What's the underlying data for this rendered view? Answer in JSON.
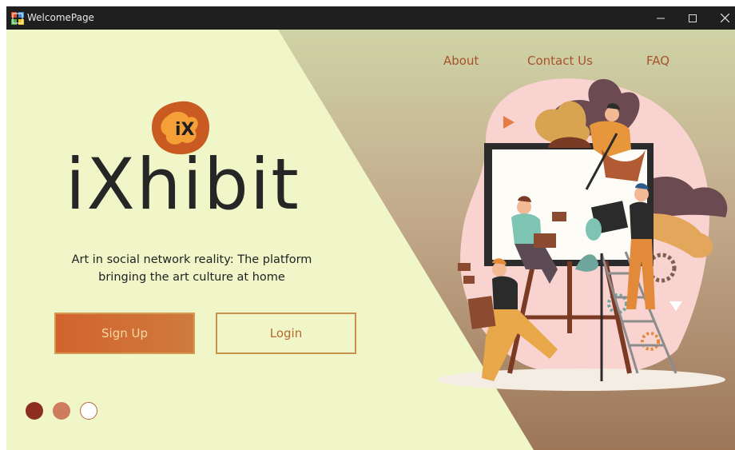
{
  "window": {
    "title": "WelcomePage",
    "controls": {
      "minimize": "minimize",
      "maximize": "maximize",
      "close": "close"
    }
  },
  "nav": {
    "about": "About",
    "contact": "Contact Us",
    "faq": "FAQ"
  },
  "brand": {
    "logo_text": "iX",
    "name": "iXhibit",
    "tagline_line1": "Art in social network reality: The platform",
    "tagline_line2": "bringing the art culture at home"
  },
  "actions": {
    "signup_label": "Sign Up",
    "login_label": "Login"
  },
  "carousel": {
    "count": 3,
    "active_index": 0
  },
  "colors": {
    "background": "#f1f6c8",
    "accent": "#d2642e",
    "nav_text": "#a8532a",
    "dot_1": "#8c2f22",
    "dot_2": "#cf7c5e",
    "dot_3": "#ffffff"
  },
  "illustration": {
    "description_icon": "artists-painting-canvas-illustration"
  }
}
